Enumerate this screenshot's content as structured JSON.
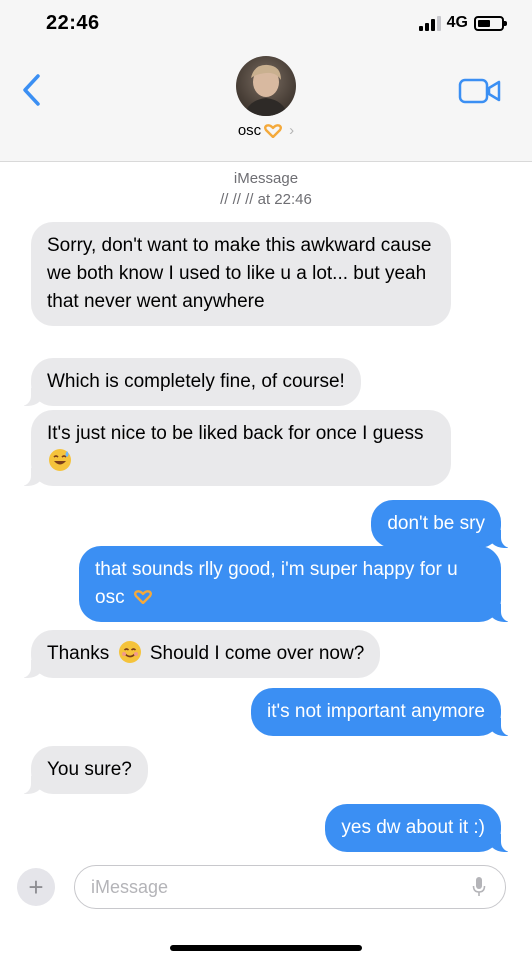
{
  "status_bar": {
    "time": "22:46",
    "network": "4G"
  },
  "header": {
    "contact_name": "osc"
  },
  "meta": {
    "service": "iMessage",
    "timestamp": "// // // at 22:46"
  },
  "messages": [
    {
      "dir": "in",
      "text": "Sorry, don't want to make this awkward cause we both know I used to like u a lot... but yeah that never went anywhere"
    },
    {
      "dir": "in",
      "text": "Which is completely fine, of course!"
    },
    {
      "dir": "in",
      "text": "It's just nice to be liked back for once I guess"
    },
    {
      "dir": "out",
      "text": "don't be sry"
    },
    {
      "dir": "out",
      "text": "that sounds rlly good, i'm super happy for u osc"
    },
    {
      "dir": "in",
      "text_a": "Thanks",
      "text_b": "Should I come over now?"
    },
    {
      "dir": "out",
      "text": "it's not important anymore"
    },
    {
      "dir": "in",
      "text": "You sure?"
    },
    {
      "dir": "out",
      "text": "yes dw about it :)"
    }
  ],
  "compose": {
    "placeholder": "iMessage",
    "plus_label": "+"
  },
  "icons": {
    "back": "chevron-left-icon",
    "video": "video-camera-icon",
    "heart_hands": "heart-hands-emoji",
    "sweat_smile": "grinning-sweat-emoji",
    "smile": "smiling-face-emoji",
    "mic": "microphone-icon"
  },
  "colors": {
    "accent": "#3b8ff3",
    "incoming_bubble": "#e9e9eb",
    "heart_hands": "#f4a93b"
  }
}
